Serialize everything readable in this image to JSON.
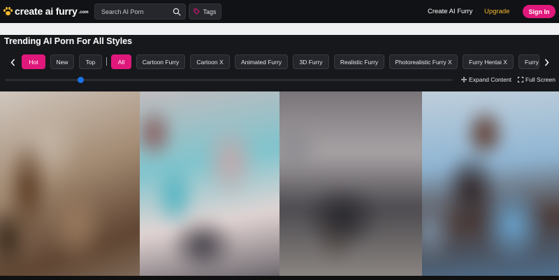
{
  "header": {
    "logo_text": "create ai furry",
    "logo_suffix": ".com",
    "search_placeholder": "Search AI Porn",
    "tags_label": "Tags",
    "nav_create": "Create AI Furry",
    "nav_upgrade": "Upgrade",
    "signin_label": "Sign In"
  },
  "section": {
    "title": "Trending AI Porn For All Styles"
  },
  "filters": {
    "sort": [
      {
        "label": "Hot",
        "active": true
      },
      {
        "label": "New",
        "active": false
      },
      {
        "label": "Top",
        "active": false
      }
    ],
    "styles": [
      {
        "label": "All",
        "active": true
      },
      {
        "label": "Cartoon Furry",
        "active": false
      },
      {
        "label": "Cartoon X",
        "active": false
      },
      {
        "label": "Animated Furry",
        "active": false
      },
      {
        "label": "3D Furry",
        "active": false
      },
      {
        "label": "Realistic Furry",
        "active": false
      },
      {
        "label": "Photorealistic Furry X",
        "active": false
      },
      {
        "label": "Furry Hentai X",
        "active": false
      },
      {
        "label": "Furry",
        "active": false
      }
    ]
  },
  "controls": {
    "slider_value": 0.17,
    "expand_label": "Expand Content",
    "fullscreen_label": "Full Screen"
  },
  "colors": {
    "accent": "#e0187c",
    "upgrade": "#f2b72e",
    "slider": "#1a73e8"
  },
  "gallery": {
    "tile_count": 4
  }
}
